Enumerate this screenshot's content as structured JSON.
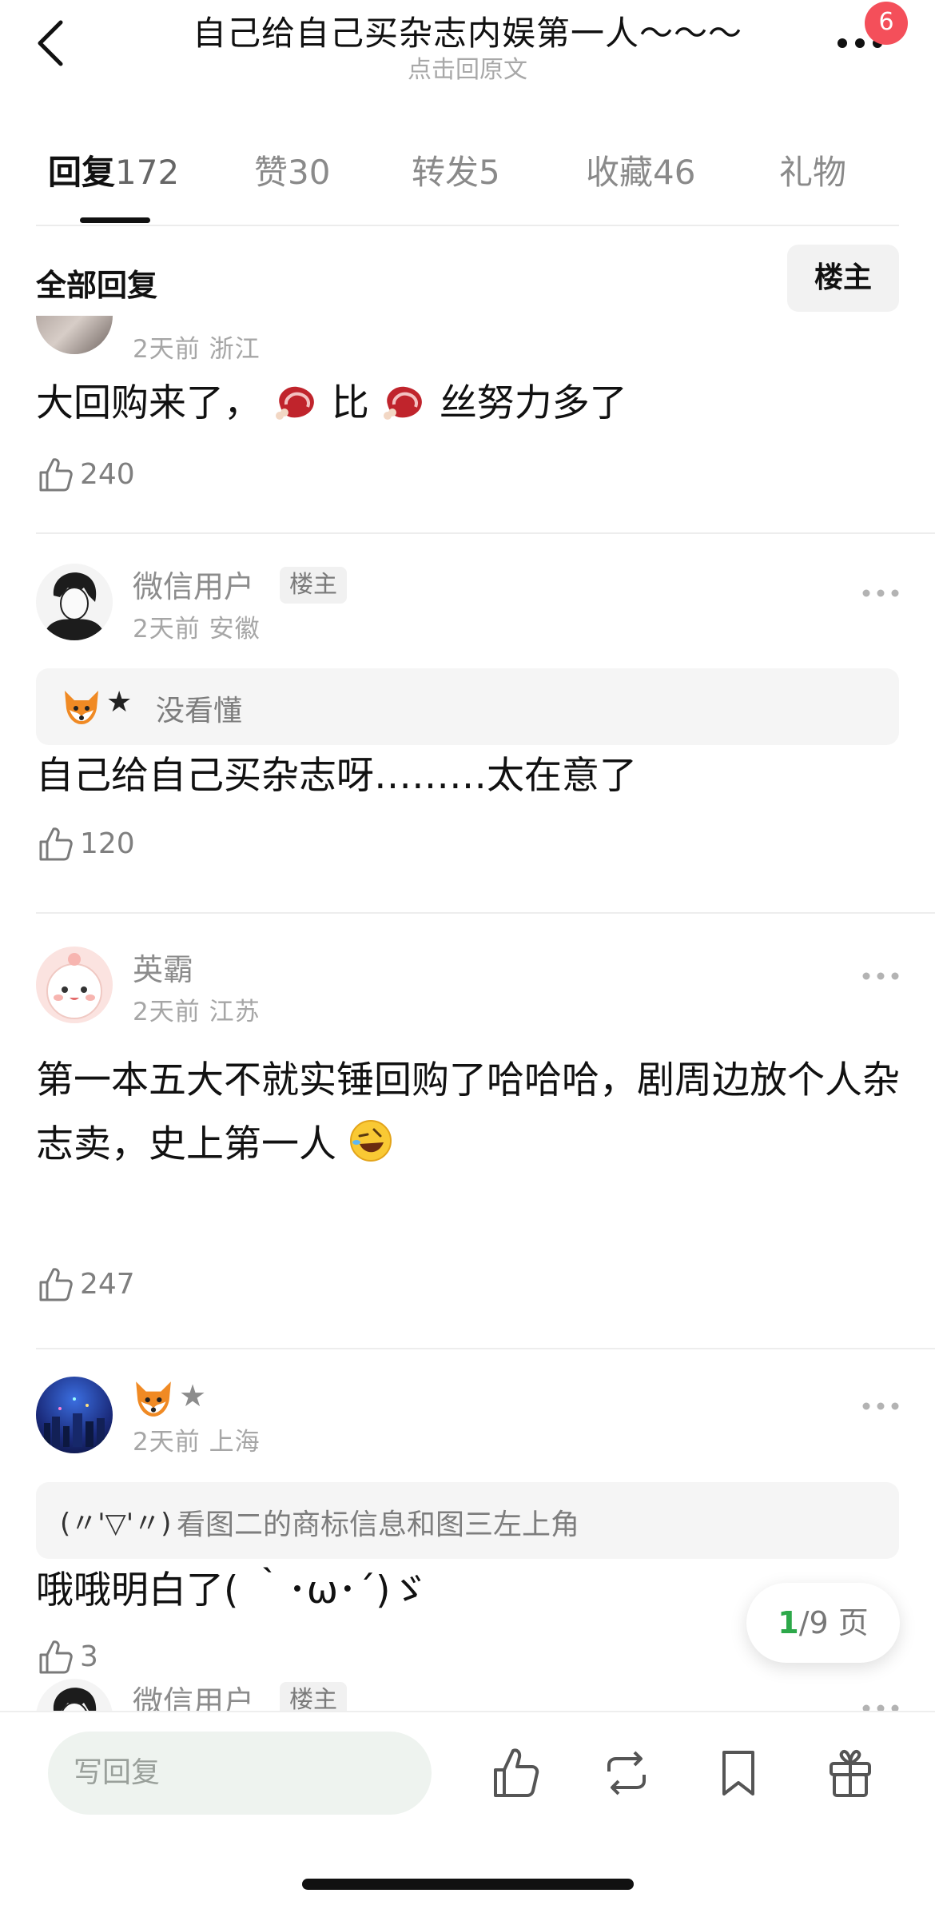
{
  "header": {
    "title": "自己给自己买杂志内娱第一人～～～",
    "subtitle": "点击回原文",
    "badge_count": "6"
  },
  "tabs": [
    {
      "label": "回复",
      "count": "172",
      "active": true
    },
    {
      "label": "赞",
      "count": "30"
    },
    {
      "label": "转发",
      "count": "5"
    },
    {
      "label": "收藏",
      "count": "46"
    },
    {
      "label": "礼物",
      "count": ""
    }
  ],
  "section": {
    "title": "全部回复",
    "filter_label": "楼主"
  },
  "comments": [
    {
      "meta": "2天前 浙江",
      "text_parts": [
        "大回购来了，",
        "比",
        "丝努力多了"
      ],
      "emoji": "steak",
      "likes": "240"
    },
    {
      "username": "微信用户",
      "tag": "楼主",
      "meta": "2天前 安徽",
      "quote_text": "没看懂",
      "quote_author_star": "★",
      "text": "自己给自己买杂志呀………太在意了",
      "likes": "120"
    },
    {
      "username": "英霸",
      "meta": "2天前 江苏",
      "text": "第一本五大不就实锤回购了哈哈哈，剧周边放个人杂志卖，史上第一人",
      "emoji": "rofl",
      "likes": "247"
    },
    {
      "username_star": "★",
      "meta": "2天前 上海",
      "quote_author": "(〃'▽'〃)",
      "quote_text": "看图二的商标信息和图三左上角",
      "text": "哦哦明白了( ｀･ω･´)ゞ",
      "likes": "3"
    },
    {
      "username": "微信用户",
      "tag": "楼主"
    }
  ],
  "pager": {
    "current": "1",
    "total_label": "/9 页"
  },
  "bottom_bar": {
    "reply_placeholder": "写回复"
  },
  "colors": {
    "accent_green": "#2da84a",
    "badge_red": "#f44f5a",
    "input_bg": "#eef3ef"
  },
  "icons": [
    "back-arrow-icon",
    "more-dots-icon",
    "thumbs-up-icon",
    "repost-icon",
    "bookmark-icon",
    "gift-icon",
    "fox-icon",
    "steak-icon",
    "rofl-emoji-icon"
  ]
}
